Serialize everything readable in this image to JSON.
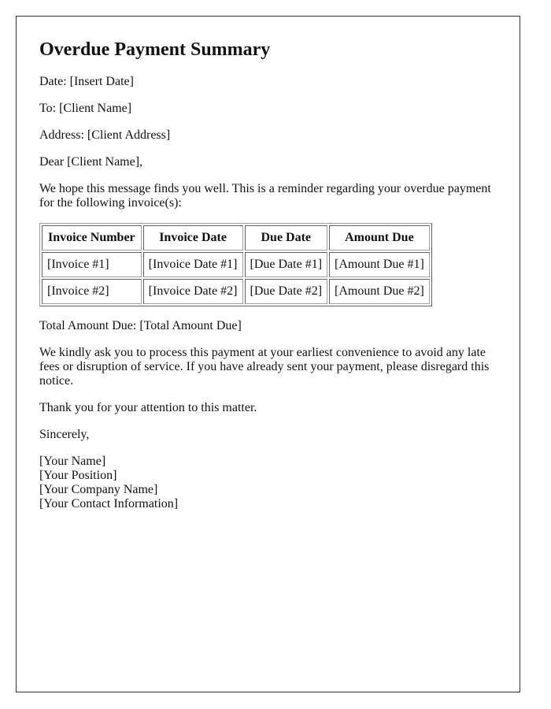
{
  "document": {
    "title": "Overdue Payment Summary",
    "date_line": "Date: [Insert Date]",
    "to_line": "To: [Client Name]",
    "address_line": "Address: [Client Address]",
    "salutation": "Dear [Client Name],",
    "intro": "We hope this message finds you well. This is a reminder regarding your overdue payment for the following invoice(s):",
    "table": {
      "headers": [
        "Invoice Number",
        "Invoice Date",
        "Due Date",
        "Amount Due"
      ],
      "rows": [
        [
          "[Invoice #1]",
          "[Invoice Date #1]",
          "[Due Date #1]",
          "[Amount Due #1]"
        ],
        [
          "[Invoice #2]",
          "[Invoice Date #2]",
          "[Due Date #2]",
          "[Amount Due #2]"
        ]
      ]
    },
    "total_line": "Total Amount Due: [Total Amount Due]",
    "request": "We kindly ask you to process this payment at your earliest convenience to avoid any late fees or disruption of service. If you have already sent your payment, please disregard this notice.",
    "thanks": "Thank you for your attention to this matter.",
    "closing": "Sincerely,",
    "signature": [
      "[Your Name]",
      "[Your Position]",
      "[Your Company Name]",
      "[Your Contact Information]"
    ]
  }
}
